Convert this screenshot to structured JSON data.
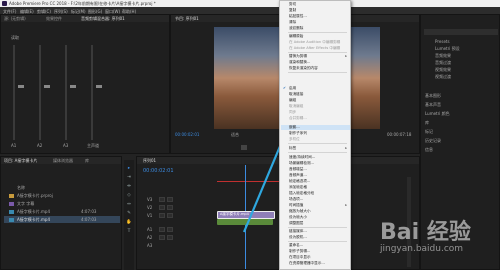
{
  "window": {
    "title": "Adobe Premiere Pro CC 2018 - F:\\2年前期有限\\在修卡片\\A接字模卡片.prproj *"
  },
  "menubar": [
    "文件(F)",
    "编辑(E)",
    "剪辑(C)",
    "序列(S)",
    "标记(M)",
    "图形(G)",
    "窗口(W)",
    "帮助(H)"
  ],
  "source_panel": {
    "tabs": [
      "源: (无剪辑)",
      "效果控件",
      "音频剪辑混合器: 序列01",
      "元数据"
    ],
    "channel_labels": [
      "A1",
      "A2",
      "A3",
      "主声道"
    ],
    "read_value": "读取"
  },
  "program_panel": {
    "tab": "节目: 序列01",
    "timecode_left": "00:00:02:01",
    "fit_label": "适合",
    "timecode_right": "00:00:07:18"
  },
  "project_panel": {
    "tabs": [
      "项目: A接字模卡片",
      "媒体浏览器",
      "库"
    ],
    "column_name": "名称",
    "items": [
      {
        "name": "A接字模卡片.prproj",
        "duration": ""
      },
      {
        "name": "文字 字幕",
        "duration": ""
      },
      {
        "name": "A接字模卡片.mp4",
        "duration": "4:07:03"
      },
      {
        "name": "A接字模卡片.mp4",
        "duration": "4:07:03"
      }
    ]
  },
  "timeline_panel": {
    "tab": "序列01",
    "timecode": "00:00:02:01",
    "tracks": [
      "V3",
      "V2",
      "V1",
      "A1",
      "A2",
      "A3"
    ],
    "clip_label": "A接字模卡片.mp4"
  },
  "effects_panel": {
    "items": [
      "Presets",
      "Lumetri 预设",
      "音频效果",
      "音频过渡",
      "视频效果",
      "视频过渡"
    ],
    "side_labels": [
      "基本图形",
      "基本声音",
      "Lumetri 颜色",
      "库",
      "标记",
      "历史记录",
      "信息"
    ]
  },
  "context_menu": {
    "items": [
      {
        "label": "剪切",
        "state": "normal"
      },
      {
        "label": "复制",
        "state": "normal"
      },
      {
        "label": "粘贴属性...",
        "state": "normal"
      },
      {
        "label": "清除",
        "state": "normal"
      },
      {
        "label": "波纹删除",
        "state": "normal"
      },
      {
        "label": "编辑原始",
        "state": "normal"
      },
      {
        "label": "在 Adobe Audition 中编辑剪辑",
        "state": "disabled"
      },
      {
        "label": "在 Adobe After Effects 中编辑",
        "state": "disabled"
      },
      {
        "label": "替换为剪辑",
        "state": "normal"
      },
      {
        "label": "渲染和替换...",
        "state": "normal"
      },
      {
        "label": "恢复未渲染的内容",
        "state": "normal"
      },
      {
        "label": "启用",
        "state": "checked"
      },
      {
        "label": "取消链接",
        "state": "normal"
      },
      {
        "label": "编组",
        "state": "normal"
      },
      {
        "label": "取消编组",
        "state": "disabled"
      },
      {
        "label": "同步",
        "state": "disabled"
      },
      {
        "label": "合并剪辑...",
        "state": "disabled"
      },
      {
        "label": "嵌套...",
        "state": "highlighted"
      },
      {
        "label": "制作子序列",
        "state": "normal"
      },
      {
        "label": "多机位",
        "state": "disabled"
      },
      {
        "label": "标签",
        "state": "normal"
      },
      {
        "label": "速度/持续时间...",
        "state": "normal"
      },
      {
        "label": "场景编辑检测...",
        "state": "normal"
      },
      {
        "label": "音频增益...",
        "state": "normal"
      },
      {
        "label": "音频声道...",
        "state": "normal"
      },
      {
        "label": "帧定格选项...",
        "state": "normal"
      },
      {
        "label": "添加帧定格",
        "state": "normal"
      },
      {
        "label": "插入帧定格分段",
        "state": "normal"
      },
      {
        "label": "场选项...",
        "state": "normal"
      },
      {
        "label": "时间插值",
        "state": "normal"
      },
      {
        "label": "缩放为帧大小",
        "state": "normal"
      },
      {
        "label": "设为帧大小",
        "state": "normal"
      },
      {
        "label": "调整图层",
        "state": "normal"
      },
      {
        "label": "链接媒体...",
        "state": "normal"
      },
      {
        "label": "设为脱机...",
        "state": "normal"
      },
      {
        "label": "重命名...",
        "state": "normal"
      },
      {
        "label": "制作子剪辑...",
        "state": "normal"
      },
      {
        "label": "在项目中显示",
        "state": "normal"
      },
      {
        "label": "在资源管理器中显示...",
        "state": "normal"
      },
      {
        "label": "属性",
        "state": "normal"
      },
      {
        "label": "显示剪辑关键帧",
        "state": "normal"
      }
    ]
  },
  "watermark": {
    "main": "Bai 经验",
    "sub": "jingyan.baidu.com"
  },
  "colors": {
    "accent": "#3c8be0",
    "menu_highlight": "#cfe3f6",
    "clip_green": "#5a8a3a",
    "arrow": "#2fa8e0"
  }
}
